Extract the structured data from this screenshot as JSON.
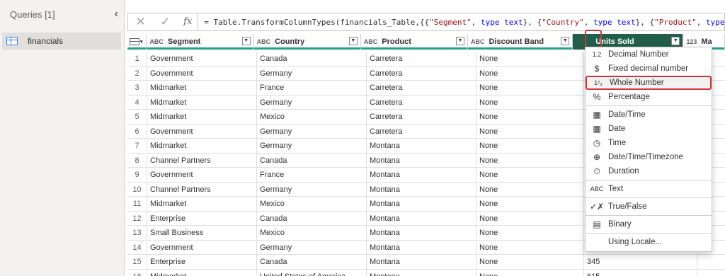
{
  "queries": {
    "title": "Queries [1]",
    "items": [
      {
        "label": "financials"
      }
    ]
  },
  "formula_bar": {
    "expression_prefix": "= Table.TransformColumnTypes(financials_Table,{{",
    "segments": [
      {
        "str": "\"Segment\"",
        "kw": "type text"
      },
      {
        "str": "\"Country\"",
        "kw": "type text"
      },
      {
        "str": "\"Product\"",
        "kw": "type te"
      }
    ]
  },
  "columns": [
    {
      "label": "Segment",
      "type": "ABC"
    },
    {
      "label": "Country",
      "type": "ABC"
    },
    {
      "label": "Product",
      "type": "ABC"
    },
    {
      "label": "Discount Band",
      "type": "ABC"
    },
    {
      "label": "Units Sold",
      "type": "",
      "active": true
    },
    {
      "label": "Ma",
      "type": "123"
    }
  ],
  "rows": [
    [
      "1",
      "Government",
      "Canada",
      "Carretera",
      "None",
      ""
    ],
    [
      "2",
      "Government",
      "Germany",
      "Carretera",
      "None",
      ""
    ],
    [
      "3",
      "Midmarket",
      "France",
      "Carretera",
      "None",
      ""
    ],
    [
      "4",
      "Midmarket",
      "Germany",
      "Carretera",
      "None",
      ""
    ],
    [
      "5",
      "Midmarket",
      "Mexico",
      "Carretera",
      "None",
      ""
    ],
    [
      "6",
      "Government",
      "Germany",
      "Carretera",
      "None",
      ""
    ],
    [
      "7",
      "Midmarket",
      "Germany",
      "Montana",
      "None",
      ""
    ],
    [
      "8",
      "Channel Partners",
      "Canada",
      "Montana",
      "None",
      ""
    ],
    [
      "9",
      "Government",
      "France",
      "Montana",
      "None",
      ""
    ],
    [
      "10",
      "Channel Partners",
      "Germany",
      "Montana",
      "None",
      ""
    ],
    [
      "11",
      "Midmarket",
      "Mexico",
      "Montana",
      "None",
      ""
    ],
    [
      "12",
      "Enterprise",
      "Canada",
      "Montana",
      "None",
      ""
    ],
    [
      "13",
      "Small Business",
      "Mexico",
      "Montana",
      "None",
      ""
    ],
    [
      "14",
      "Government",
      "Germany",
      "Montana",
      "None",
      ""
    ],
    [
      "15",
      "Enterprise",
      "Canada",
      "Montana",
      "None",
      "345"
    ],
    [
      "16",
      "Midmarket",
      "United States of America",
      "Montana",
      "None",
      "615"
    ]
  ],
  "type_menu": {
    "items": [
      {
        "icon": "1.2",
        "label": "Decimal Number"
      },
      {
        "icon": "$",
        "label": "Fixed decimal number"
      },
      {
        "icon": "1²₃",
        "label": "Whole Number",
        "selected": true
      },
      {
        "icon": "%",
        "label": "Percentage",
        "sep_after": true
      },
      {
        "icon": "▦",
        "label": "Date/Time"
      },
      {
        "icon": "▦",
        "label": "Date"
      },
      {
        "icon": "◷",
        "label": "Time"
      },
      {
        "icon": "⊕",
        "label": "Date/Time/Timezone"
      },
      {
        "icon": "⏱",
        "label": "Duration",
        "sep_after": true
      },
      {
        "icon": "ABC",
        "label": "Text",
        "sep_after": true
      },
      {
        "icon": "✓✗",
        "label": "True/False",
        "sep_after": true
      },
      {
        "icon": "▤",
        "label": "Binary",
        "sep_after": true
      },
      {
        "icon": "",
        "label": "Using Locale..."
      }
    ]
  },
  "colors": {
    "accent": "#1fa38a",
    "active_header": "#215f4a",
    "highlight": "#d13438"
  }
}
